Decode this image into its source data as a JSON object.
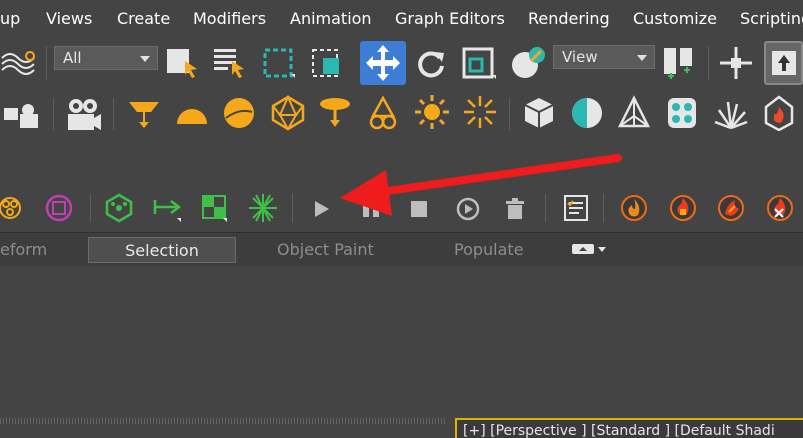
{
  "menu": {
    "items": [
      {
        "label": "up"
      },
      {
        "label": "Views"
      },
      {
        "label": "Create"
      },
      {
        "label": "Modifiers"
      },
      {
        "label": "Animation"
      },
      {
        "label": "Graph Editors"
      },
      {
        "label": "Rendering"
      },
      {
        "label": "Customize"
      },
      {
        "label": "Scripting"
      }
    ]
  },
  "main_toolbar": {
    "selection_filter": "All",
    "reference_coord": "View"
  },
  "ribbon": {
    "tabs": [
      {
        "label": "eform"
      },
      {
        "label": "Selection",
        "active": true
      },
      {
        "label": "Object Paint"
      },
      {
        "label": "Populate"
      }
    ]
  },
  "viewport": {
    "label": "[+] [Perspective ] [Standard ] [Default Shadi"
  },
  "colors": {
    "accent_orange": "#f6a81a",
    "accent_teal": "#2ab8b0",
    "active_blue": "#3d7dd6",
    "green": "#3fbf4a",
    "annotation_red": "#ee1c1c",
    "viewport_border": "#e1b200"
  }
}
